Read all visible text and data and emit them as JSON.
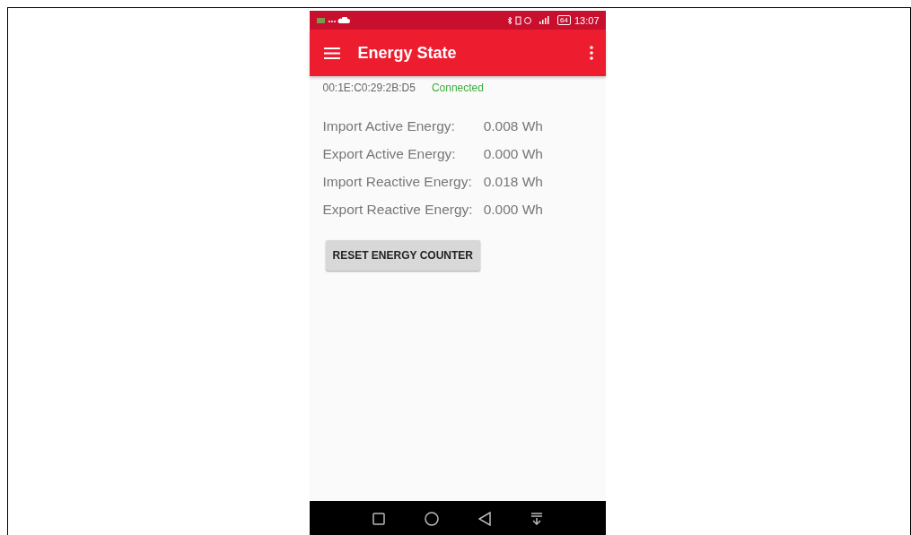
{
  "status_bar": {
    "battery": "64",
    "time": "13:07"
  },
  "app_bar": {
    "title": "Energy State"
  },
  "device": {
    "address": "00:1E:C0:29:2B:D5",
    "status": "Connected"
  },
  "readings": [
    {
      "label": "Import Active Energy:",
      "value": "0.008 Wh"
    },
    {
      "label": "Export Active Energy:",
      "value": "0.000 Wh"
    },
    {
      "label": "Import Reactive Energy:",
      "value": "0.018 Wh"
    },
    {
      "label": "Export Reactive Energy:",
      "value": "0.000 Wh"
    }
  ],
  "reset_button": "RESET ENERGY COUNTER"
}
